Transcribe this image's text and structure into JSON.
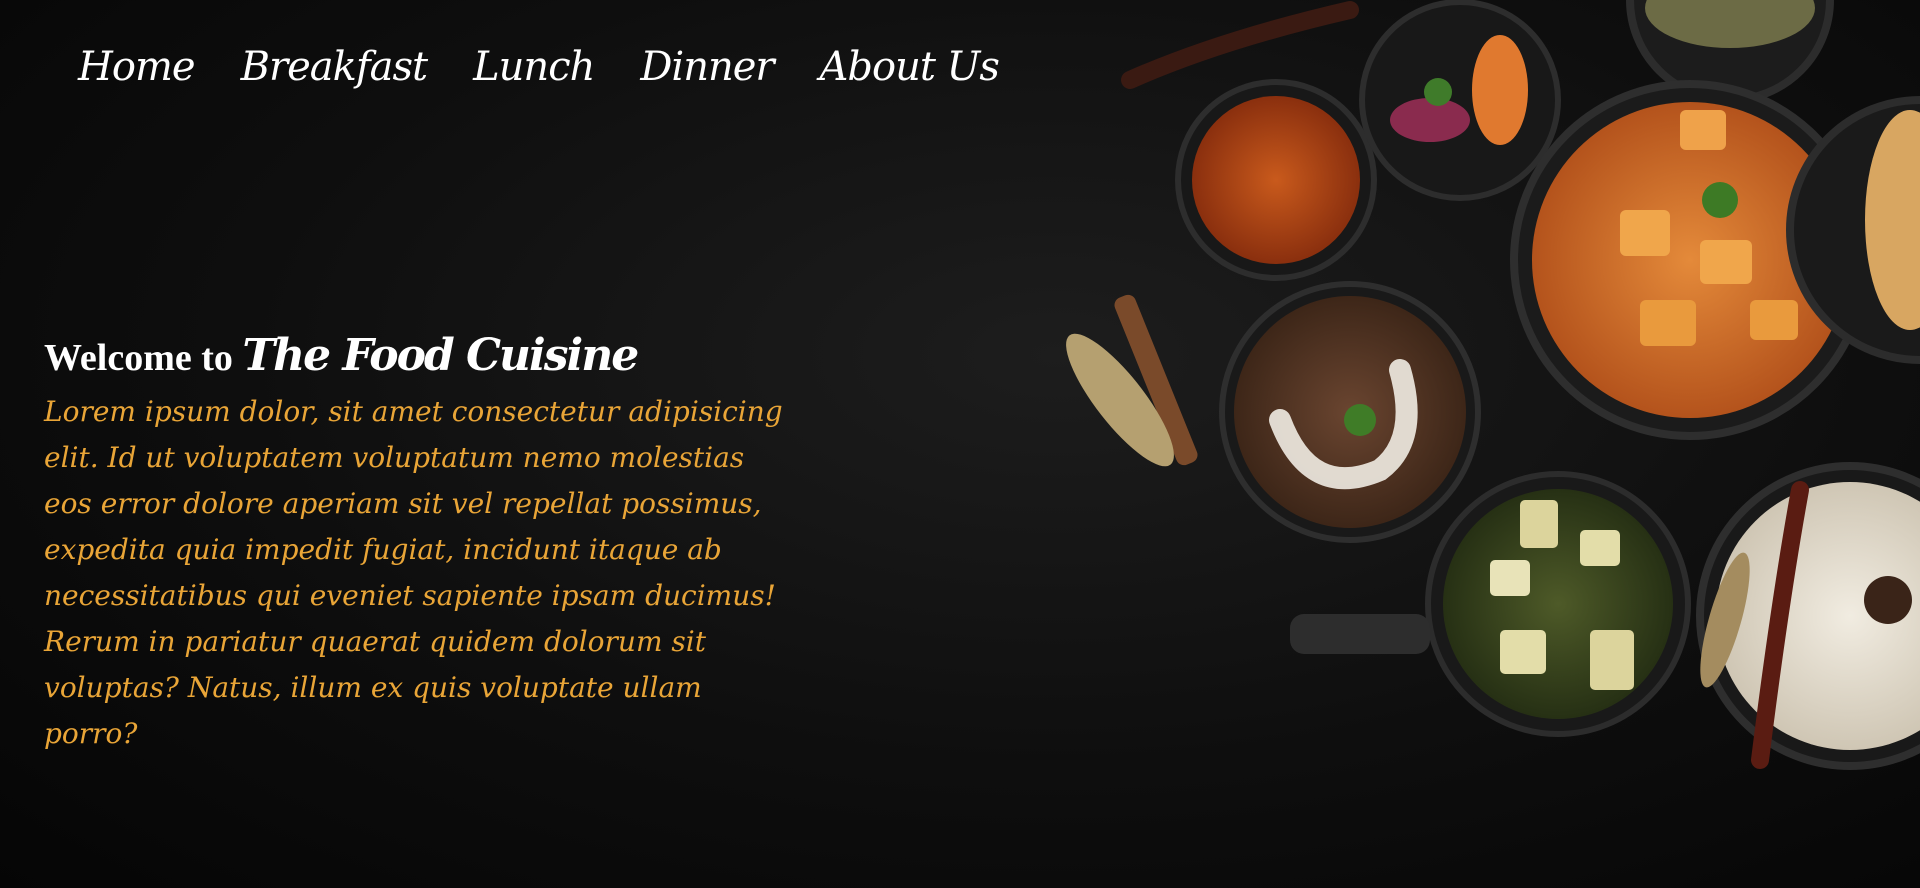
{
  "nav": {
    "items": [
      "Home",
      "Breakfast",
      "Lunch",
      "Dinner",
      "About Us"
    ]
  },
  "hero": {
    "welcome_prefix": "Welcome to",
    "brand": "The Food Cuisine",
    "description": "Lorem ipsum dolor, sit amet consectetur adipisicing elit. Id ut voluptatem voluptatum nemo molestias eos error dolore aperiam sit vel repellat possimus, expedita quia impedit fugiat, incidunt itaque ab necessitatibus qui eveniet sapiente ipsam ducimus! Rerum in pariatur quaerat quidem dolorum sit voluptas? Natus, illum ex quis voluptate ullam porro?"
  },
  "colors": {
    "background": "#0e0e0e",
    "text": "#ffffff",
    "accent": "#e9a537"
  }
}
